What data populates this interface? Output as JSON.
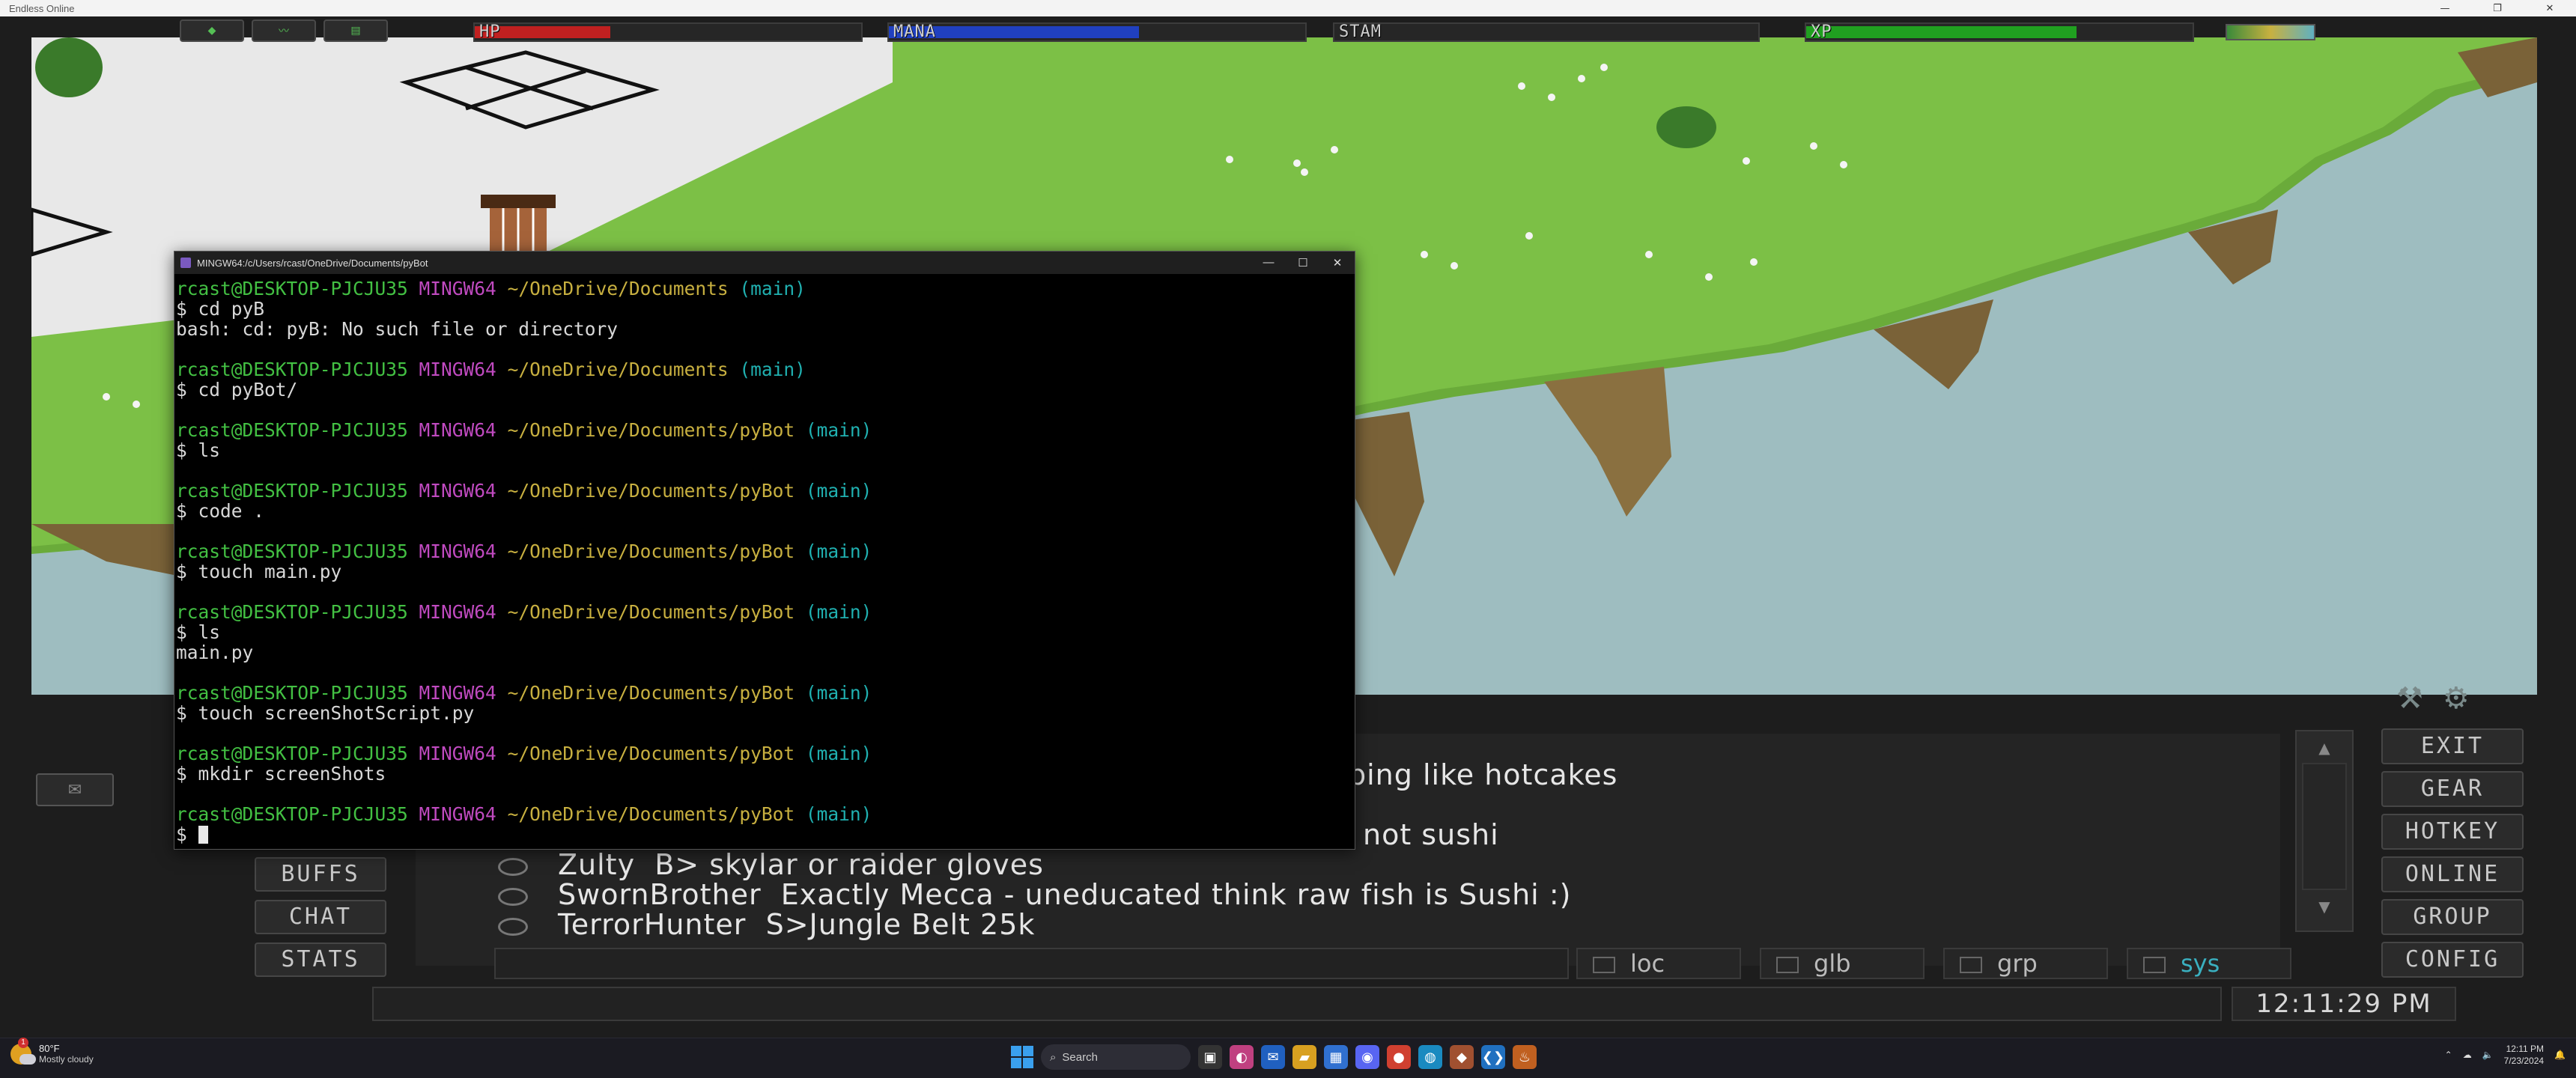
{
  "window": {
    "title": "Endless Online",
    "controls": [
      "—",
      "❐",
      "✕"
    ]
  },
  "hud": {
    "bars": [
      {
        "label": "HP",
        "fill_percent": 35,
        "color": "#c02020"
      },
      {
        "label": "MANA",
        "fill_percent": 60,
        "color": "#2040c0"
      },
      {
        "label": "STAM",
        "fill_percent": 0,
        "color": "#c0c020"
      },
      {
        "label": "XP",
        "fill_percent": 70,
        "color": "#20a020"
      }
    ]
  },
  "terminal": {
    "title": "MINGW64:/c/Users/rcast/OneDrive/Documents/pyBot",
    "controls": [
      "—",
      "☐",
      "✕"
    ],
    "prompts": [
      {
        "user": "rcast@DESKTOP-PJCJU35",
        "host": "MINGW64",
        "path": "~/OneDrive/Documents",
        "branch": "(main)",
        "command": "$ cd pyB",
        "output": [
          "bash: cd: pyB: No such file or directory"
        ]
      },
      {
        "user": "rcast@DESKTOP-PJCJU35",
        "host": "MINGW64",
        "path": "~/OneDrive/Documents",
        "branch": "(main)",
        "command": "$ cd pyBot/",
        "output": []
      },
      {
        "user": "rcast@DESKTOP-PJCJU35",
        "host": "MINGW64",
        "path": "~/OneDrive/Documents/pyBot",
        "branch": "(main)",
        "command": "$ ls",
        "output": []
      },
      {
        "user": "rcast@DESKTOP-PJCJU35",
        "host": "MINGW64",
        "path": "~/OneDrive/Documents/pyBot",
        "branch": "(main)",
        "command": "$ code .",
        "output": []
      },
      {
        "user": "rcast@DESKTOP-PJCJU35",
        "host": "MINGW64",
        "path": "~/OneDrive/Documents/pyBot",
        "branch": "(main)",
        "command": "$ touch main.py",
        "output": []
      },
      {
        "user": "rcast@DESKTOP-PJCJU35",
        "host": "MINGW64",
        "path": "~/OneDrive/Documents/pyBot",
        "branch": "(main)",
        "command": "$ ls",
        "output": [
          "main.py"
        ]
      },
      {
        "user": "rcast@DESKTOP-PJCJU35",
        "host": "MINGW64",
        "path": "~/OneDrive/Documents/pyBot",
        "branch": "(main)",
        "command": "$ touch screenShotScript.py",
        "output": []
      },
      {
        "user": "rcast@DESKTOP-PJCJU35",
        "host": "MINGW64",
        "path": "~/OneDrive/Documents/pyBot",
        "branch": "(main)",
        "command": "$ mkdir screenShots",
        "output": []
      },
      {
        "user": "rcast@DESKTOP-PJCJU35",
        "host": "MINGW64",
        "path": "~/OneDrive/Documents/pyBot",
        "branch": "(main)",
        "command": "$ ",
        "output": []
      }
    ]
  },
  "chat": {
    "partial_lines": [
      "ping like hotcakes",
      "not sushi"
    ],
    "lines": [
      {
        "name": "Zulty",
        "text": "B> skylar or raider gloves"
      },
      {
        "name": "SwornBrother",
        "text": "Exactly Mecca - uneducated think raw fish is Sushi :)"
      },
      {
        "name": "TerrorHunter",
        "text": "S>Jungle Belt 25k"
      }
    ],
    "tabs": [
      {
        "label": "loc",
        "active": false
      },
      {
        "label": "glb",
        "active": false
      },
      {
        "label": "grp",
        "active": false
      },
      {
        "label": "sys",
        "active": true
      }
    ],
    "clock": "12:11:29 PM"
  },
  "left_buttons": [
    "BUFFS",
    "CHAT",
    "STATS"
  ],
  "right_buttons": [
    "EXIT",
    "GEAR",
    "HOTKEY",
    "ONLINE",
    "GROUP",
    "CONFIG"
  ],
  "taskbar": {
    "weather_temp": "80°F",
    "weather_cond": "Mostly cloudy",
    "weather_badge": "1",
    "search_placeholder": "Search",
    "time": "12:11 PM",
    "date": "7/23/2024"
  }
}
